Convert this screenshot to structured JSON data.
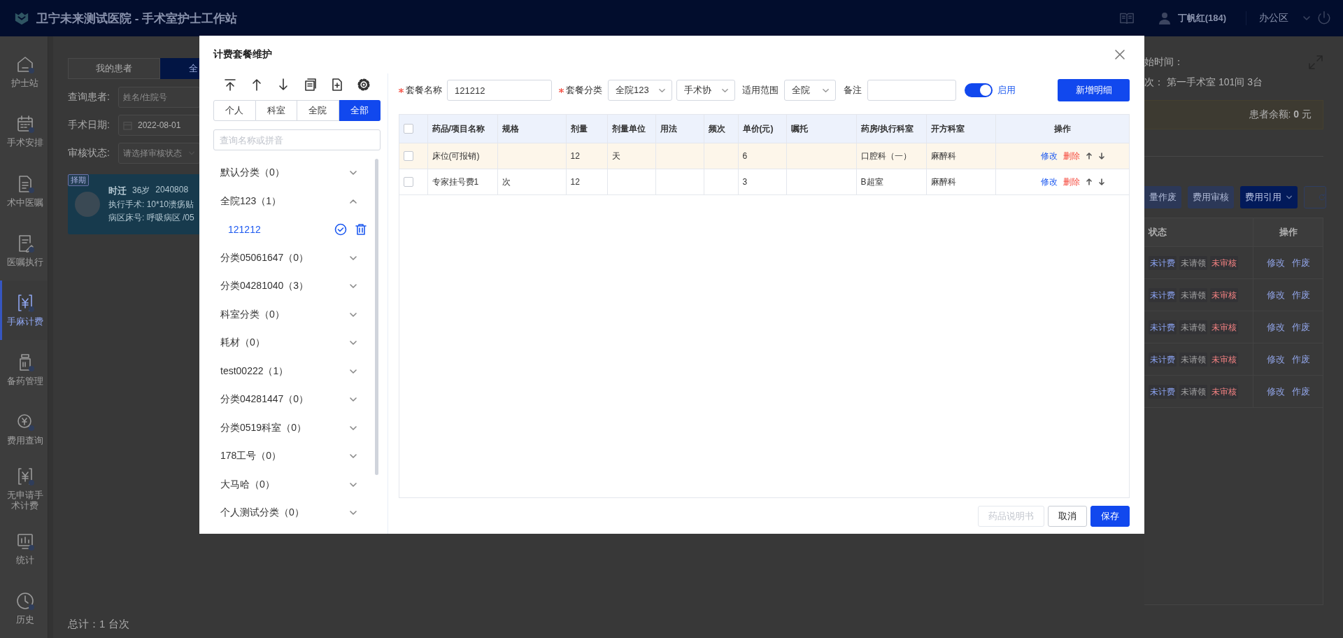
{
  "header": {
    "title": "卫宁未来测试医院 - 手术室护士工作站",
    "user": "丁帆红(184)",
    "area": "办公区"
  },
  "sidebar": {
    "items": [
      {
        "label": "护士站",
        "selected": false
      },
      {
        "label": "手术安排",
        "selected": false
      },
      {
        "label": "术中医嘱",
        "selected": false
      },
      {
        "label": "医嘱执行",
        "selected": false
      },
      {
        "label": "手麻计费",
        "selected": true
      },
      {
        "label": "备药管理",
        "selected": false
      },
      {
        "label": "费用查询",
        "selected": false
      },
      {
        "label": "无申请手术计费",
        "selected": false
      },
      {
        "label": "统计",
        "selected": false
      },
      {
        "label": "历史",
        "selected": false
      }
    ]
  },
  "patient_list": {
    "tabs": [
      {
        "label": "我的患者",
        "selected": false
      },
      {
        "label": "全",
        "selected": true
      }
    ],
    "filters": [
      {
        "label": "查询患者:",
        "kind": "text",
        "placeholder": "姓名/住院号"
      },
      {
        "label": "手术日期:",
        "kind": "date",
        "value": "2022-08-01"
      },
      {
        "label": "审核状态:",
        "kind": "select",
        "placeholder": "请选择审核状态"
      }
    ],
    "card": {
      "badge": "择期",
      "name": "时迁",
      "age": "36岁",
      "number": "2040808",
      "surgery": "执行手术: 10*10溃疡贴",
      "ward": "病区床号: 呼吸病区 /05"
    },
    "total": "总计：1 台次"
  },
  "detail": {
    "start_time": "始时间：",
    "room_label": "次：",
    "room_value": "第一手术室 101间 3台",
    "balance": "患者余额: **0** 元",
    "buttons": [
      {
        "label": "量作废",
        "kind": "plain"
      },
      {
        "label": "费用审核",
        "kind": "plain"
      },
      {
        "label": "费用引用",
        "kind": "dropdown"
      }
    ],
    "table": {
      "columns": [
        "状态",
        "操作"
      ],
      "rows": [
        {
          "tags": [
            {
              "label": "未计费",
              "color": "#8aa2f0"
            },
            {
              "label": "未请领",
              "color": "#a0a0a0"
            },
            {
              "label": "未审核",
              "color": "#f08080"
            }
          ],
          "actions": [
            "修改",
            "作废"
          ]
        },
        {
          "tags": [
            {
              "label": "未计费",
              "color": "#8aa2f0"
            },
            {
              "label": "未请领",
              "color": "#a0a0a0"
            },
            {
              "label": "未审核",
              "color": "#f08080"
            }
          ],
          "actions": [
            "修改",
            "作废"
          ]
        },
        {
          "tags": [
            {
              "label": "未计费",
              "color": "#8aa2f0"
            },
            {
              "label": "未请领",
              "color": "#a0a0a0"
            },
            {
              "label": "未审核",
              "color": "#f08080"
            }
          ],
          "actions": [
            "修改",
            "作废"
          ]
        },
        {
          "tags": [
            {
              "label": "未计费",
              "color": "#8aa2f0"
            },
            {
              "label": "未请领",
              "color": "#a0a0a0"
            },
            {
              "label": "未审核",
              "color": "#f08080"
            }
          ],
          "actions": [
            "修改",
            "作废"
          ]
        },
        {
          "tags": [
            {
              "label": "未计费",
              "color": "#8aa2f0"
            },
            {
              "label": "未请领",
              "color": "#a0a0a0"
            },
            {
              "label": "未审核",
              "color": "#f08080"
            }
          ],
          "actions": [
            "修改",
            "作废"
          ]
        }
      ]
    }
  },
  "dialog": {
    "title": "计费套餐维护",
    "scope_tabs": [
      {
        "label": "个人",
        "selected": false
      },
      {
        "label": "科室",
        "selected": false
      },
      {
        "label": "全院",
        "selected": false
      },
      {
        "label": "全部",
        "selected": true
      }
    ],
    "search": {
      "placeholder": "查询名称或拼音"
    },
    "categories": [
      {
        "label": "默认分类（0）",
        "expanded": false
      },
      {
        "label": "全院123（1）",
        "expanded": true,
        "children": [
          {
            "label": "121212",
            "selected": true
          }
        ]
      },
      {
        "label": "分类05061647（0）",
        "expanded": false
      },
      {
        "label": "分类04281040（3）",
        "expanded": false
      },
      {
        "label": "科室分类（0）",
        "expanded": false
      },
      {
        "label": "耗材（0）",
        "expanded": false
      },
      {
        "label": "test00222（1）",
        "expanded": false
      },
      {
        "label": "分类04281447（0）",
        "expanded": false
      },
      {
        "label": "分类0519科室（0）",
        "expanded": false
      },
      {
        "label": "178工号（0）",
        "expanded": false
      },
      {
        "label": "大马哈（0）",
        "expanded": false
      },
      {
        "label": "个人测试分类（0）",
        "expanded": false
      }
    ],
    "form": {
      "fields": [
        {
          "label": "套餐名称",
          "required": true,
          "kind": "input",
          "value": "121212"
        },
        {
          "label": "套餐分类",
          "required": true,
          "kind": "select",
          "value": "全院123"
        },
        {
          "kind": "select",
          "value": "手术协"
        },
        {
          "label": "适用范围",
          "required": false,
          "kind": "select",
          "value": "全院"
        },
        {
          "label": "备注",
          "required": false,
          "kind": "input"
        }
      ],
      "enabled": {
        "on": true,
        "label": "启用"
      },
      "add_button": "新增明细"
    },
    "table": {
      "all_checked": false,
      "columns": [
        "药品/项目名称",
        "规格",
        "剂量",
        "剂量单位",
        "用法",
        "频次",
        "单价(元)",
        "嘱托",
        "药房/执行科室",
        "开方科室",
        "操作"
      ],
      "rows": [
        {
          "selected": true,
          "checked": false,
          "cells": [
            "床位(可报销)",
            null,
            "12",
            "天",
            null,
            null,
            "6",
            null,
            "口腔科（一）",
            "麻醉科"
          ],
          "actions": [
            "修改",
            "删除"
          ]
        },
        {
          "selected": false,
          "checked": false,
          "cells": [
            "专家挂号费1",
            "次",
            "12",
            null,
            null,
            null,
            "3",
            null,
            "B超室",
            "麻醉科"
          ],
          "actions": [
            "修改",
            "删除"
          ]
        }
      ]
    },
    "footer_buttons": [
      {
        "label": "药品说明书",
        "kind": "default",
        "disabled": true
      },
      {
        "label": "取消",
        "kind": "default",
        "disabled": false
      },
      {
        "label": "保存",
        "kind": "primary",
        "disabled": false
      }
    ]
  }
}
